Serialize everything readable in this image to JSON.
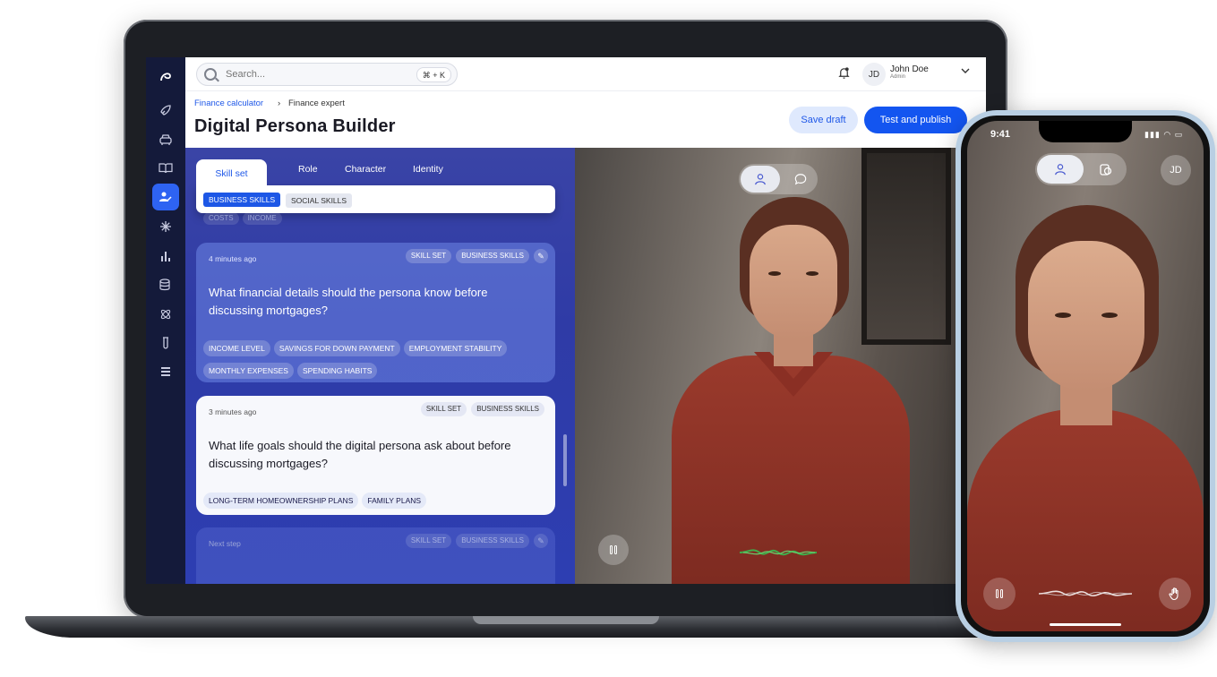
{
  "topbar": {
    "search_placeholder": "Search...",
    "shortcut": "⌘ + K",
    "user_initials": "JD",
    "user_name": "John Doe",
    "user_role": "Admin"
  },
  "breadcrumb": {
    "parent": "Finance calculator",
    "separator": "›",
    "current": "Finance expert"
  },
  "page": {
    "title": "Digital Persona Builder"
  },
  "actions": {
    "save_draft": "Save draft",
    "publish": "Test and publish"
  },
  "tabs": [
    "Skill set",
    "Role",
    "Character",
    "Identity"
  ],
  "subtabs": [
    "BUSINESS SKILLS",
    "SOCIAL SKILLS"
  ],
  "ghost_chips": [
    "COSTS",
    "INCOME"
  ],
  "cards": [
    {
      "time": "4 minutes ago",
      "tags": [
        "SKILL SET",
        "BUSINESS SKILLS"
      ],
      "question": "What financial details should the persona know before discussing mortgages?",
      "chips": [
        "INCOME LEVEL",
        "SAVINGS FOR DOWN PAYMENT",
        "EMPLOYMENT STABILITY",
        "MONTHLY EXPENSES",
        "SPENDING HABITS"
      ]
    },
    {
      "time": "3 minutes ago",
      "tags": [
        "SKILL SET",
        "BUSINESS SKILLS"
      ],
      "question": "What life goals should the digital persona ask about before discussing mortgages?",
      "chips": [
        "LONG-TERM HOMEOWNERSHIP PLANS",
        "FAMILY PLANS"
      ]
    },
    {
      "time": "Next step",
      "tags": [
        "SKILL SET",
        "BUSINESS SKILLS"
      ]
    }
  ],
  "phone": {
    "time": "9:41",
    "status": "▮▮▮ ◠ ▭",
    "user_initials": "JD"
  },
  "icons": {
    "sidebar": [
      "logo-icon",
      "rocket-icon",
      "car-icon",
      "book-icon",
      "persona-edit-icon",
      "asterisk-icon",
      "bar-chart-icon",
      "database-icon",
      "atom-icon",
      "test-tube-icon",
      "stack-icon"
    ]
  },
  "colors": {
    "accent": "#1355f0",
    "panel": "#2f3ba6",
    "sidebar": "#141a3a"
  }
}
